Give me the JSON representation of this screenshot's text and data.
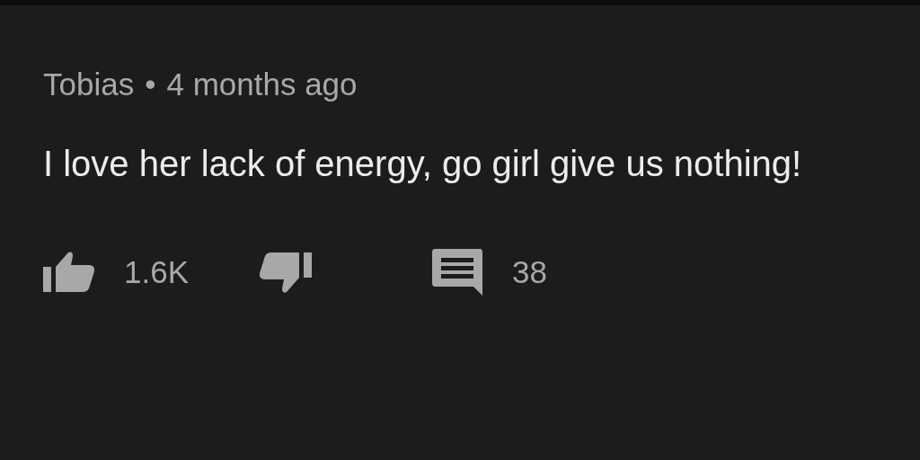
{
  "comment": {
    "author": "Tobias",
    "separator": "•",
    "time": "4 months ago",
    "text": "I love her lack of energy, go girl give us nothing!",
    "likes": "1.6K",
    "replies": "38"
  }
}
